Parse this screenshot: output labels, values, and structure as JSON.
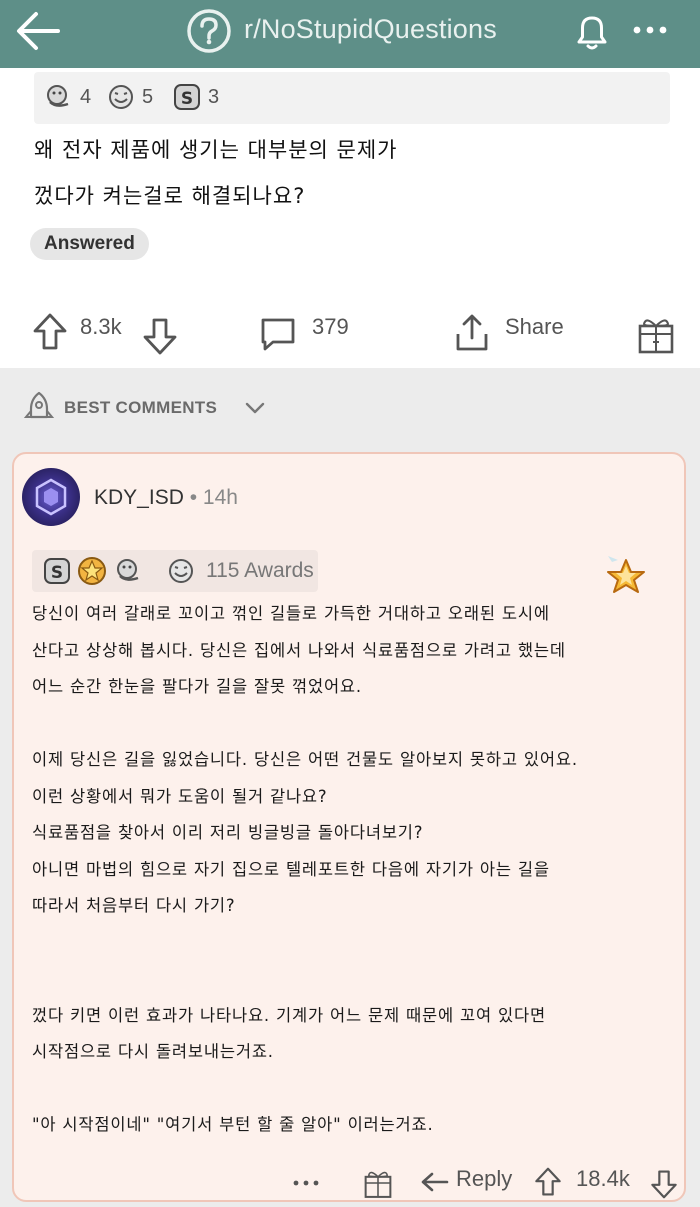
{
  "header": {
    "subreddit": "r/NoStupidQuestions",
    "back_icon": "arrow-left-icon",
    "subreddit_icon": "question-mark-icon",
    "bell_icon": "bell-icon",
    "more_icon": "more-horizontal-icon",
    "bar_color": "#5e8f88"
  },
  "post": {
    "awards": [
      {
        "icon": "hug-award-icon",
        "count": "4"
      },
      {
        "icon": "wholesome-award-icon",
        "count": "5"
      },
      {
        "icon": "silver-award-icon",
        "count": "3"
      }
    ],
    "title_lines": [
      "왜 전자 제품에 생기는 대부분의 문제가",
      "껐다가 켜는걸로 해결되나요?"
    ],
    "flair": "Answered",
    "upvotes": "8.3k",
    "comments": "379",
    "share_label": "Share"
  },
  "best_comments": {
    "label": "BEST COMMENTS",
    "icon": "rocket-icon"
  },
  "comment": {
    "author": "KDY_ISD",
    "time": "14h",
    "awards_label": "115 Awards",
    "award_icons": [
      "silver-award-icon",
      "gold-award-icon",
      "hug-award-icon",
      "wholesome-award-icon"
    ],
    "body_lines": [
      "당신이 여러 갈래로 꼬이고 꺾인 길들로 가득한 거대하고 오래된 도시에",
      "산다고 상상해 봅시다. 당신은 집에서 나와서 식료품점으로 가려고 했는데",
      "어느 순간 한눈을 팔다가 길을 잘못 꺾었어요.",
      "",
      "이제 당신은 길을 잃었습니다. 당신은 어떤 건물도 알아보지 못하고 있어요.",
      "이런 상황에서 뭐가 도움이 될거 같나요?",
      "식료품점을 찾아서 이리 저리 빙글빙글 돌아다녀보기?",
      "아니면 마법의 힘으로 자기 집으로 텔레포트한 다음에 자기가 아는 길을",
      "따라서 처음부터 다시 가기?",
      "",
      "",
      "껐다 키면 이런 효과가 나타나요. 기계가 어느 문제 때문에 꼬여 있다면",
      "시작점으로 다시 돌려보내는거죠.",
      "",
      "\"아 시작점이네\" \"여기서 부턴 할 줄 알아\" 이러는거죠."
    ],
    "reply_label": "Reply",
    "score": "18.4k",
    "accent": "#f0c6b8",
    "background": "#fdf1ec"
  }
}
